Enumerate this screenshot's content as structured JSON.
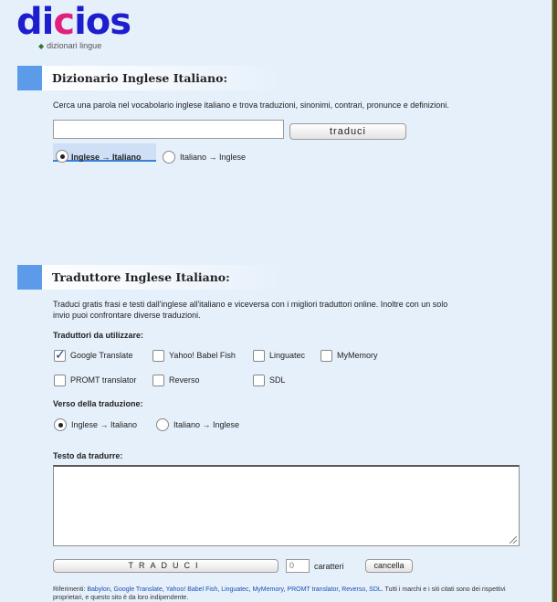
{
  "logo": {
    "part1": "di",
    "part2": "c",
    "part3": "ios",
    "subtitle": "dizionari lingue"
  },
  "dictionary": {
    "title": "Dizionario Inglese Italiano:",
    "description": "Cerca una parola nel vocabolario inglese italiano e trova traduzioni, sinonimi, contrari, pronunce e definizioni.",
    "search_value": "",
    "button_label": "traduci",
    "directions": [
      {
        "label": "Inglese → Italiano",
        "selected": true
      },
      {
        "label": "Italiano → Inglese",
        "selected": false
      }
    ]
  },
  "translator": {
    "title": "Traduttore Inglese Italiano:",
    "description_line1": "Traduci gratis frasi e testi dall'inglese all'italiano e viceversa con i migliori traduttori online. Inoltre con un solo",
    "description_line2": "invio puoi confrontare diverse traduzioni.",
    "engines_label": "Traduttori da utilizzare:",
    "engines": [
      {
        "label": "Google Translate",
        "checked": true
      },
      {
        "label": "Yahoo! Babel Fish",
        "checked": false
      },
      {
        "label": "Linguatec",
        "checked": false
      },
      {
        "label": "MyMemory",
        "checked": false
      },
      {
        "label": "PROMT translator",
        "checked": false
      },
      {
        "label": "Reverso",
        "checked": false
      },
      {
        "label": "SDL",
        "checked": false
      }
    ],
    "direction_label": "Verso della traduzione:",
    "directions": [
      {
        "label": "Inglese → Italiano",
        "selected": true
      },
      {
        "label": "Italiano → Inglese",
        "selected": false
      }
    ],
    "text_label": "Testo da tradurre:",
    "text_value": "",
    "translate_button": "TRADUCI",
    "char_count": "0",
    "char_label": "caratteri",
    "cancel_button": "cancella"
  },
  "footer": {
    "prefix": "Riferimenti: ",
    "links": [
      "Babylon",
      "Google Translate",
      "Yahoo! Babel Fish",
      "Linguatec",
      "MyMemory",
      "PROMT translator",
      "Reverso",
      "SDL"
    ],
    "suffix": ". Tutti i marchi e i siti citati sono dei rispettivi proprietari, e questo sito è da loro indipendente."
  },
  "colors": {
    "accent": "#5b9bea",
    "background": "#e6f0fb",
    "link": "#1a4fb6"
  },
  "icons": {
    "logo_bullet": "diamond-icon"
  }
}
